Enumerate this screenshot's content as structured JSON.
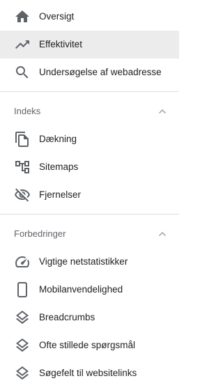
{
  "top_items": [
    {
      "label": "Oversigt",
      "icon": "home-icon",
      "active": false
    },
    {
      "label": "Effektivitet",
      "icon": "trending-up-icon",
      "active": true
    },
    {
      "label": "Undersøgelse af webadresse",
      "icon": "search-icon",
      "active": false
    }
  ],
  "sections": [
    {
      "title": "Indeks",
      "expanded": true,
      "items": [
        {
          "label": "Dækning",
          "icon": "copy-pages-icon"
        },
        {
          "label": "Sitemaps",
          "icon": "sitemap-icon"
        },
        {
          "label": "Fjernelser",
          "icon": "eye-off-icon"
        }
      ]
    },
    {
      "title": "Forbedringer",
      "expanded": true,
      "items": [
        {
          "label": "Vigtige netstatistikker",
          "icon": "speedometer-icon"
        },
        {
          "label": "Mobilanvendelighed",
          "icon": "phone-icon"
        },
        {
          "label": "Breadcrumbs",
          "icon": "layers-icon"
        },
        {
          "label": "Ofte stillede spørgsmål",
          "icon": "layers-icon"
        },
        {
          "label": "Søgefelt til websitelinks",
          "icon": "layers-icon"
        }
      ]
    }
  ],
  "colors": {
    "active_background": "#ececec",
    "icon": "#5f6368",
    "icon_active": "#5f6368",
    "divider": "#dadce0",
    "section_title": "#5f6368"
  }
}
